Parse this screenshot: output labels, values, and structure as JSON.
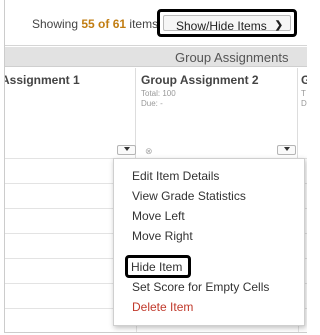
{
  "toolbar": {
    "showing_prefix": "Showing ",
    "showing_count": "55 of 61",
    "showing_suffix": " items",
    "show_hide_label": "Show/Hide Items"
  },
  "group_header": "Group Assignments",
  "columns": [
    {
      "title": "Assignment 1"
    },
    {
      "title": "Group Assignment 2",
      "total": "Total: 100",
      "due": "Due: -"
    },
    {
      "title": "G",
      "total": "T",
      "due": "D"
    }
  ],
  "menu": {
    "items": [
      "Edit Item Details",
      "View Grade Statistics",
      "Move Left",
      "Move Right",
      "Hide Item",
      "Set Score for Empty Cells",
      "Delete Item"
    ]
  },
  "colors": {
    "count_highlight": "#c17d12",
    "delete": "#c0392b"
  }
}
